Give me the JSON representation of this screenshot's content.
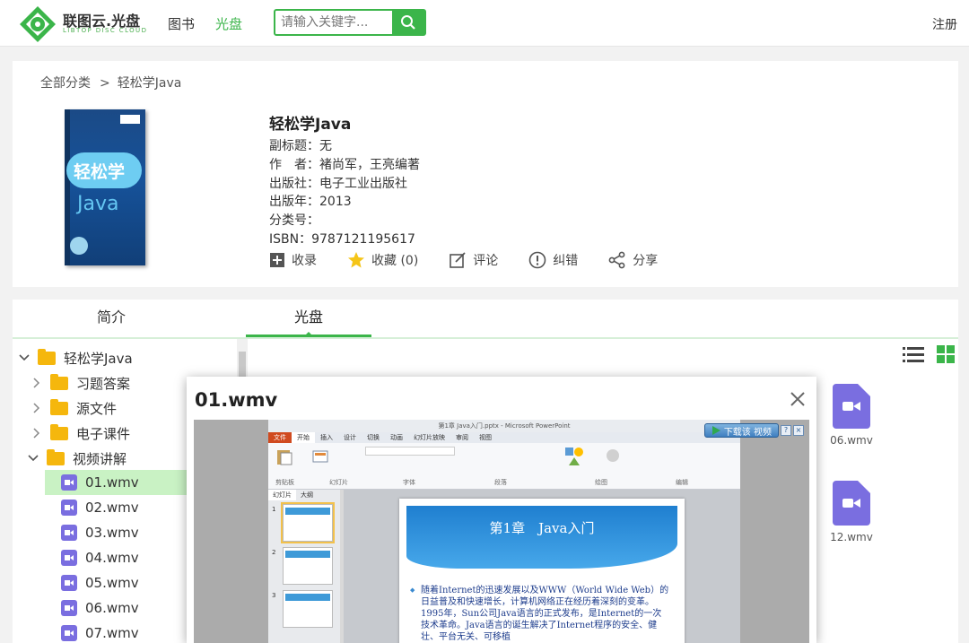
{
  "header": {
    "logo_title": "联图云.光盘",
    "logo_subtitle": "LIBTOP DISC CLOUD",
    "nav": [
      {
        "label": "图书",
        "active": false
      },
      {
        "label": "光盘",
        "active": true
      }
    ],
    "search": {
      "placeholder": "请输入关键字...",
      "value": ""
    },
    "register_label": "注册",
    "accent_color": "#3bb54a"
  },
  "breadcrumb": {
    "root": "全部分类",
    "separator": ">",
    "current": "轻松学Java"
  },
  "book": {
    "cover_title": "轻松学",
    "cover_subtitle": "Java",
    "title": "轻松学Java",
    "subtitle": "副标题：无",
    "author": "作　者：褚尚军，王亮编著",
    "publisher": "出版社：电子工业出版社",
    "year": "出版年：2013",
    "category": "分类号：",
    "isbn": "ISBN：9787121195617"
  },
  "actions": [
    {
      "label": "收录",
      "icon": "plus-square-icon"
    },
    {
      "label": "收藏 (0)",
      "icon": "star-icon"
    },
    {
      "label": "评论",
      "icon": "edit-icon"
    },
    {
      "label": "纠错",
      "icon": "alert-circle-icon"
    },
    {
      "label": "分享",
      "icon": "share-icon"
    }
  ],
  "tabs": [
    {
      "label": "简介",
      "active": false
    },
    {
      "label": "光盘",
      "active": true
    }
  ],
  "tree": {
    "root": "轻松学Java",
    "folders": [
      "习题答案",
      "源文件",
      "电子课件",
      "视频讲解"
    ],
    "videos": [
      "01.wmv",
      "02.wmv",
      "03.wmv",
      "04.wmv",
      "05.wmv",
      "06.wmv",
      "07.wmv"
    ],
    "selected": "01.wmv"
  },
  "file_grid": [
    {
      "name": "06.wmv"
    },
    {
      "name": "12.wmv"
    }
  ],
  "modal": {
    "title": "01.wmv",
    "ppt": {
      "window_title": "第1章 Java入门.pptx - Microsoft PowerPoint",
      "tabs": [
        "文件",
        "开始",
        "插入",
        "设计",
        "切换",
        "动画",
        "幻灯片放映",
        "审阅",
        "视图"
      ],
      "groups": [
        "剪贴板",
        "幻灯片",
        "字体",
        "段落",
        "绘图",
        "编辑"
      ],
      "side_tabs": [
        "幻灯片",
        "大纲"
      ],
      "slide_title": "第1章　Java入门",
      "slide_body": "随着Internet的迅速发展以及WWW（World Wide Web）的日益普及和快速增长，计算机网络正在经历着深刻的变革。1995年，Sun公司Java语言的正式发布，是Internet的一次技术革命。Java语言的诞生解决了Internet程序的安全、健壮、平台无关、可移植"
    },
    "download_label": "下载该 视频"
  }
}
